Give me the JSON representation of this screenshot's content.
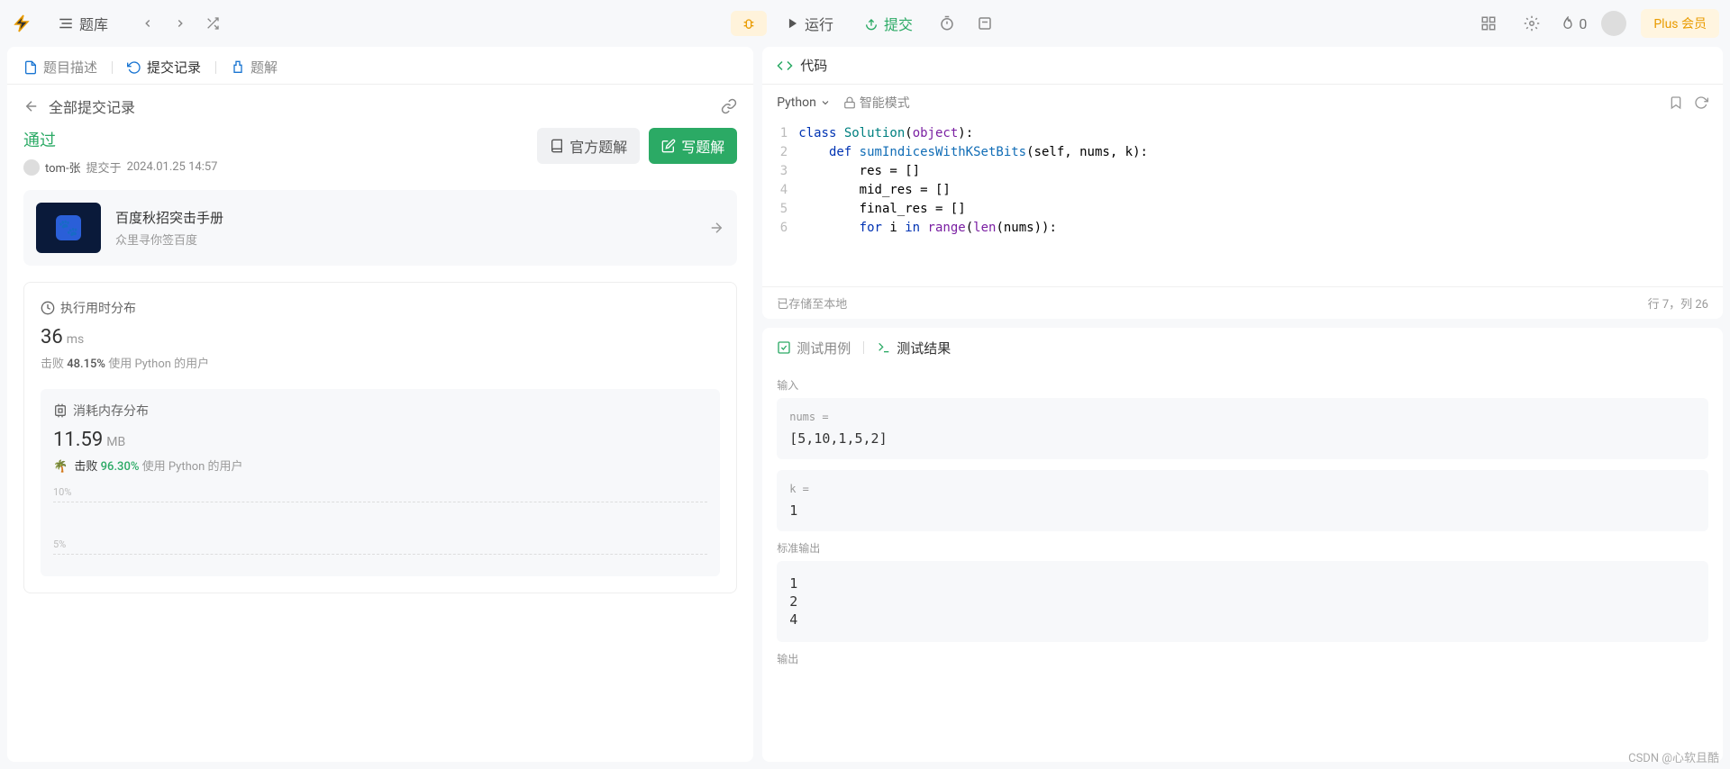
{
  "topbar": {
    "problem_lib": "题库",
    "run": "运行",
    "submit": "提交",
    "fire_count": "0",
    "plus": "Plus 会员"
  },
  "left": {
    "tabs": {
      "desc": "题目描述",
      "submissions": "提交记录",
      "solutions": "题解"
    },
    "subheader": "全部提交记录",
    "status": "通过",
    "author": "tom-张",
    "submit_prefix": "提交于",
    "submit_time": "2024.01.25 14:57",
    "official_btn": "官方题解",
    "write_btn": "写题解",
    "promo": {
      "title": "百度秋招突击手册",
      "subtitle": "众里寻你签百度"
    },
    "exec_time_title": "执行用时分布",
    "exec_time_value": "36",
    "exec_time_unit": "ms",
    "exec_time_beat_label": "击败",
    "exec_time_beat": "48.15%",
    "exec_time_lang": "使用 Python 的用户",
    "mem_title": "消耗内存分布",
    "mem_value": "11.59",
    "mem_unit": "MB",
    "mem_beat_label": "击败",
    "mem_beat": "96.30%",
    "mem_lang": "使用 Python 的用户",
    "chart_labels": [
      "10%",
      "5%"
    ]
  },
  "code": {
    "title": "代码",
    "language": "Python",
    "mode": "智能模式",
    "saved": "已存储至本地",
    "cursor": "行 7，列 26",
    "lines": [
      {
        "n": 1,
        "tokens": [
          {
            "t": "class ",
            "c": "kw"
          },
          {
            "t": "Solution",
            "c": "cls"
          },
          {
            "t": "(",
            "c": ""
          },
          {
            "t": "object",
            "c": "builtin"
          },
          {
            "t": "):",
            "c": ""
          }
        ]
      },
      {
        "n": 2,
        "tokens": [
          {
            "t": "    ",
            "c": ""
          },
          {
            "t": "def ",
            "c": "kw"
          },
          {
            "t": "sumIndicesWithKSetBits",
            "c": "fn"
          },
          {
            "t": "(self, nums, k):",
            "c": ""
          }
        ]
      },
      {
        "n": 3,
        "tokens": [
          {
            "t": "        res = []",
            "c": ""
          }
        ]
      },
      {
        "n": 4,
        "tokens": [
          {
            "t": "        mid_res = []",
            "c": ""
          }
        ]
      },
      {
        "n": 5,
        "tokens": [
          {
            "t": "        final_res = []",
            "c": ""
          }
        ]
      },
      {
        "n": 6,
        "tokens": [
          {
            "t": "        ",
            "c": ""
          },
          {
            "t": "for ",
            "c": "kw"
          },
          {
            "t": "i ",
            "c": ""
          },
          {
            "t": "in ",
            "c": "kw"
          },
          {
            "t": "range",
            "c": "builtin"
          },
          {
            "t": "(",
            "c": ""
          },
          {
            "t": "len",
            "c": "builtin"
          },
          {
            "t": "(nums)):",
            "c": ""
          }
        ]
      }
    ]
  },
  "test": {
    "tab_cases": "测试用例",
    "tab_result": "测试结果",
    "input_label": "输入",
    "nums_label": "nums =",
    "nums_value": "[5,10,1,5,2]",
    "k_label": "k =",
    "k_value": "1",
    "stdout_label": "标准输出",
    "stdout_lines": [
      "1",
      "2",
      "4"
    ],
    "output_label": "输出"
  },
  "watermark": "CSDN @心软且酷"
}
